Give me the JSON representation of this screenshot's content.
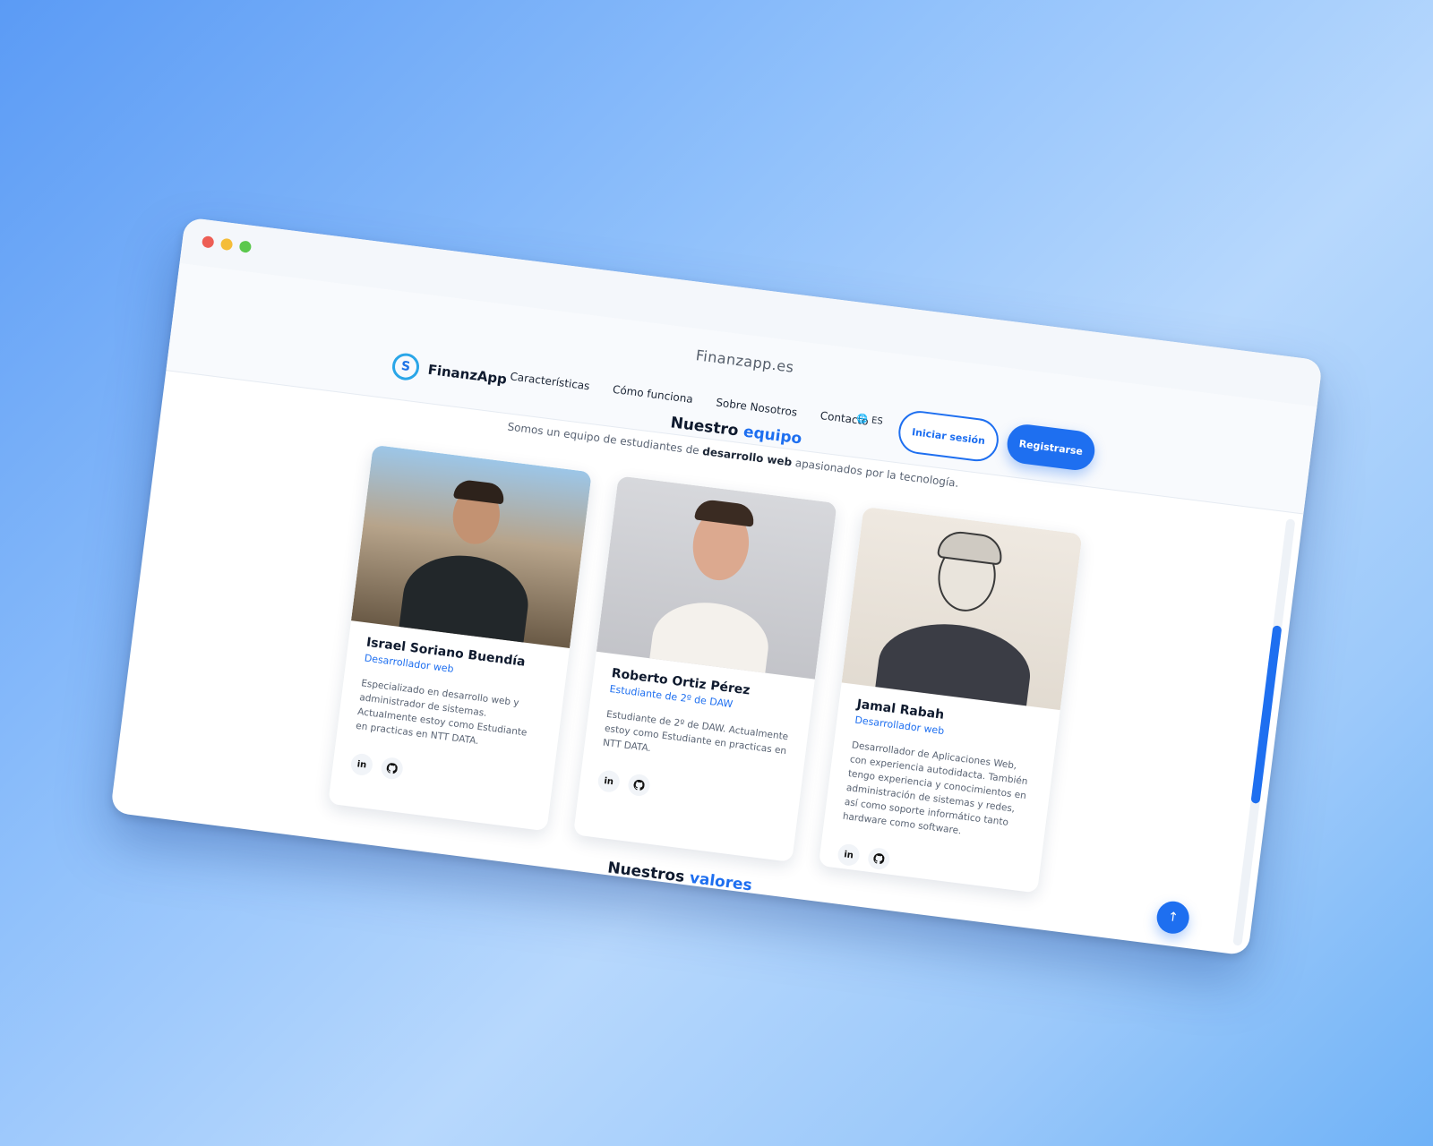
{
  "window": {
    "url": "Finanzapp.es"
  },
  "brand": {
    "name": "FinanzApp",
    "mark": "S"
  },
  "nav": {
    "items": [
      "Características",
      "Cómo funciona",
      "Sobre Nosotros",
      "Contacto"
    ],
    "lang": "ES",
    "login_label": "Iniciar sesión",
    "register_label": "Registrarse"
  },
  "team": {
    "title_main": "Nuestro",
    "title_accent": "equipo",
    "subtitle_pre": "Somos un equipo de estudiantes de",
    "subtitle_bold": "desarrollo web",
    "subtitle_post": "apasionados por la tecnología.",
    "members": [
      {
        "name": "Israel Soriano Buendía",
        "role": "Desarrollador web",
        "desc": "Especializado en desarrollo web y administrador de sistemas. Actualmente estoy como Estudiante en practicas en NTT DATA."
      },
      {
        "name": "Roberto Ortiz Pérez",
        "role": "Estudiante de 2º de DAW",
        "desc": "Estudiante de 2º de DAW. Actualmente estoy como Estudiante en practicas en NTT DATA."
      },
      {
        "name": "Jamal Rabah",
        "role": "Desarrollador web",
        "desc": "Desarrollador de Aplicaciones Web, con experiencia autodidacta. También tengo experiencia y conocimientos en administración de sistemas y redes, así como soporte informático tanto hardware como software."
      }
    ]
  },
  "values": {
    "title_main": "Nuestros",
    "title_accent": "valores"
  },
  "social": {
    "linkedin": "in",
    "github": "⌥"
  },
  "colors": {
    "accent": "#1e6ff0",
    "text": "#0f1a2e"
  }
}
